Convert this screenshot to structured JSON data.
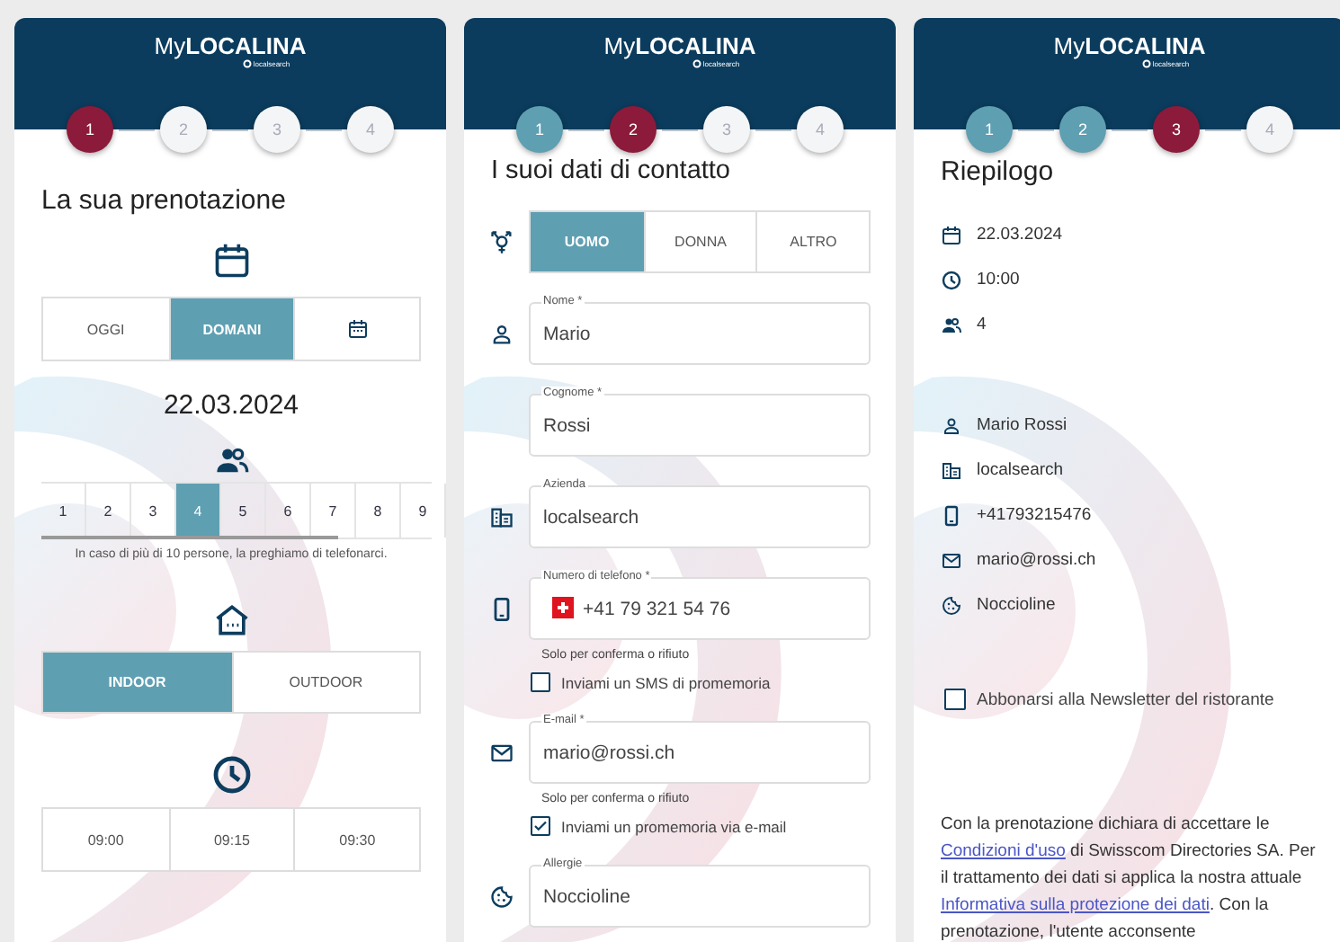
{
  "screens": [
    {
      "kind": "booking",
      "brand": {
        "prefix": "My",
        "name": "LOCALINA",
        "sub": "localsearch"
      },
      "steps": [
        {
          "label": "1",
          "kind": "current"
        },
        {
          "label": "2",
          "kind": "todo"
        },
        {
          "label": "3",
          "kind": "todo"
        },
        {
          "label": "4",
          "kind": "todo"
        }
      ],
      "title": "La sua prenotazione",
      "days": [
        {
          "kind": "text",
          "label": "OGGI",
          "selected": false
        },
        {
          "kind": "text",
          "label": "DOMANI",
          "selected": true
        },
        {
          "kind": "calendar",
          "selected": false
        }
      ],
      "date": "22.03.2024",
      "guests": [
        {
          "label": "1",
          "selected": false
        },
        {
          "label": "2",
          "selected": false
        },
        {
          "label": "3",
          "selected": false
        },
        {
          "label": "4",
          "selected": true
        },
        {
          "label": "5",
          "selected": false
        },
        {
          "label": "6",
          "selected": false
        },
        {
          "label": "7",
          "selected": false
        },
        {
          "label": "8",
          "selected": false
        },
        {
          "label": "9",
          "selected": false
        }
      ],
      "guests_note": "In caso di più di 10 persone, la preghiamo di telefonarci.",
      "areas": [
        {
          "label": "INDOOR",
          "selected": true
        },
        {
          "label": "OUTDOOR",
          "selected": false
        }
      ],
      "times": [
        {
          "label": "09:00",
          "selected": false
        },
        {
          "label": "09:15",
          "selected": false
        },
        {
          "label": "09:30",
          "selected": false
        }
      ]
    },
    {
      "kind": "contact",
      "brand": {
        "prefix": "My",
        "name": "LOCALINA",
        "sub": "localsearch"
      },
      "steps": [
        {
          "label": "1",
          "kind": "done"
        },
        {
          "label": "2",
          "kind": "current"
        },
        {
          "label": "3",
          "kind": "todo"
        },
        {
          "label": "4",
          "kind": "todo"
        }
      ],
      "title": "I suoi dati di contatto",
      "genders": [
        {
          "label": "UOMO",
          "selected": true
        },
        {
          "label": "DONNA",
          "selected": false
        },
        {
          "label": "ALTRO",
          "selected": false
        }
      ],
      "fields": [
        {
          "kind": "name",
          "label": "Nome *",
          "value": "Mario"
        },
        {
          "kind": "surname",
          "label": "Cognome *",
          "value": "Rossi"
        },
        {
          "kind": "company",
          "label": "Azienda",
          "value": "localsearch"
        },
        {
          "kind": "phone",
          "label": "Numero di telefono *",
          "value": "+41 79 321 54 76",
          "hint": "Solo per conferma o rifiuto",
          "checkbox": {
            "label": "Inviami un SMS di promemoria",
            "checked": false
          }
        },
        {
          "kind": "email",
          "label": "E-mail *",
          "value": "mario@rossi.ch",
          "hint": "Solo per conferma o rifiuto",
          "checkbox": {
            "label": "Inviami un promemoria via e-mail",
            "checked": true
          }
        },
        {
          "kind": "allergies",
          "label": "Allergie",
          "value": "Noccioline"
        }
      ]
    },
    {
      "kind": "summary",
      "brand": {
        "prefix": "My",
        "name": "LOCALINA",
        "sub": "localsearch"
      },
      "steps": [
        {
          "label": "1",
          "kind": "done"
        },
        {
          "label": "2",
          "kind": "done"
        },
        {
          "label": "3",
          "kind": "current"
        },
        {
          "label": "4",
          "kind": "todo"
        }
      ],
      "title": "Riepilogo",
      "booking_items": [
        {
          "kind": "date",
          "text": "22.03.2024"
        },
        {
          "kind": "time",
          "text": "10:00"
        },
        {
          "kind": "guests",
          "text": "4"
        }
      ],
      "contact_items": [
        {
          "kind": "name",
          "text": "Mario Rossi"
        },
        {
          "kind": "company",
          "text": "localsearch"
        },
        {
          "kind": "phone",
          "text": "+41793215476"
        },
        {
          "kind": "email",
          "text": "mario@rossi.ch"
        },
        {
          "kind": "allergies",
          "text": "Noccioline"
        }
      ],
      "newsletter": {
        "label": "Abbonarsi alla Newsletter del ristorante",
        "checked": false
      },
      "legal": [
        {
          "kind": "text",
          "text": "Con la prenotazione dichiara di accettare le "
        },
        {
          "kind": "link",
          "text": "Condizioni d'uso"
        },
        {
          "kind": "text",
          "text": " di Swisscom Directories SA. Per il trattamento dei dati si applica la nostra attuale "
        },
        {
          "kind": "link",
          "text": "Informativa sulla protezione dei dati"
        },
        {
          "kind": "text",
          "text": ". Con la prenotazione, l'utente acconsente"
        }
      ]
    }
  ]
}
